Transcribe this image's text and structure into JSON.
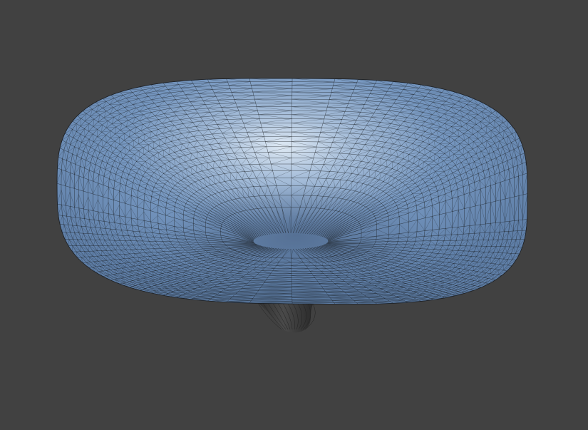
{
  "viewport": {
    "background_color": "#414141",
    "object_type": "funnel-shaped triangulated surface mesh",
    "surface_color": "#6f92bb",
    "highlight_color": "#d6e3f0",
    "wire_color": "#1b1f24",
    "stem_color": "#3a3a3a"
  }
}
